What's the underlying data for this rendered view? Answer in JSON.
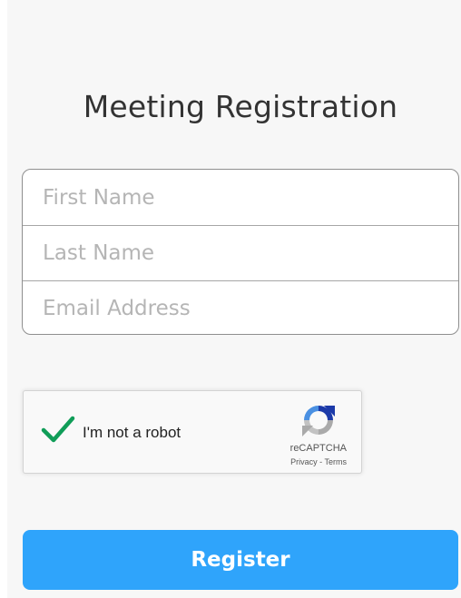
{
  "page": {
    "title": "Meeting Registration"
  },
  "form": {
    "first_name": {
      "placeholder": "First Name",
      "value": ""
    },
    "last_name": {
      "placeholder": "Last Name",
      "value": ""
    },
    "email": {
      "placeholder": "Email Address",
      "value": ""
    }
  },
  "captcha": {
    "label": "I'm not a robot",
    "checked": true,
    "brand": "reCAPTCHA",
    "privacy_link": "Privacy",
    "separator": " - ",
    "terms_link": "Terms",
    "check_icon": "checkmark-icon",
    "logo_icon": "recaptcha-logo-icon"
  },
  "actions": {
    "register_label": "Register"
  },
  "colors": {
    "accent": "#2fa4fb",
    "check": "#109d58",
    "background": "#f7f7f7"
  }
}
